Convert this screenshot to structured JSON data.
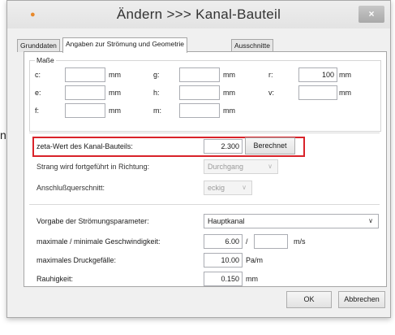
{
  "stray_text": "n",
  "dialog": {
    "app_icon": "●",
    "title": "Ändern >>> Kanal-Bauteil",
    "close_glyph": "×"
  },
  "tabs": [
    "Grunddaten",
    "Angaben zur Strömung und Geometrie",
    "Ausschnitte"
  ],
  "masse": {
    "legend": "Maße",
    "rows": [
      [
        {
          "label": "c:",
          "value": "",
          "unit": "mm"
        },
        {
          "label": "g:",
          "value": "",
          "unit": "mm"
        },
        {
          "label": "r:",
          "value": "100",
          "unit": "mm"
        }
      ],
      [
        {
          "label": "e:",
          "value": "",
          "unit": "mm"
        },
        {
          "label": "h:",
          "value": "",
          "unit": "mm"
        },
        {
          "label": "v:",
          "value": "",
          "unit": "mm"
        }
      ],
      [
        {
          "label": "f:",
          "value": "",
          "unit": "mm"
        },
        {
          "label": "m:",
          "value": "",
          "unit": "mm"
        }
      ]
    ]
  },
  "zeta": {
    "label": "zeta-Wert des Kanal-Bauteils:",
    "value": "2.300",
    "button": "Berechnet"
  },
  "strang": {
    "label": "Strang wird fortgeführt in Richtung:",
    "value": "Durchgang"
  },
  "anschluss": {
    "label": "Anschlußquerschnitt:",
    "value": "eckig"
  },
  "stroemung": {
    "label": "Vorgabe der Strömungsparameter:",
    "value": "Hauptkanal"
  },
  "geschwindigkeit": {
    "label": "maximale / minimale Geschwindigkeit:",
    "max": "6.00",
    "sep": "/",
    "min": "",
    "unit": "m/s"
  },
  "druckgefaelle": {
    "label": "maximales Druckgefälle:",
    "value": "10.00",
    "unit": "Pa/m"
  },
  "rauhigkeit": {
    "label": "Rauhigkeit:",
    "value": "0.150",
    "unit": "mm"
  },
  "buttons": {
    "ok": "OK",
    "cancel": "Abbrechen"
  },
  "colors": {
    "highlight": "#d9232a",
    "app_icon": "#e8892b"
  }
}
